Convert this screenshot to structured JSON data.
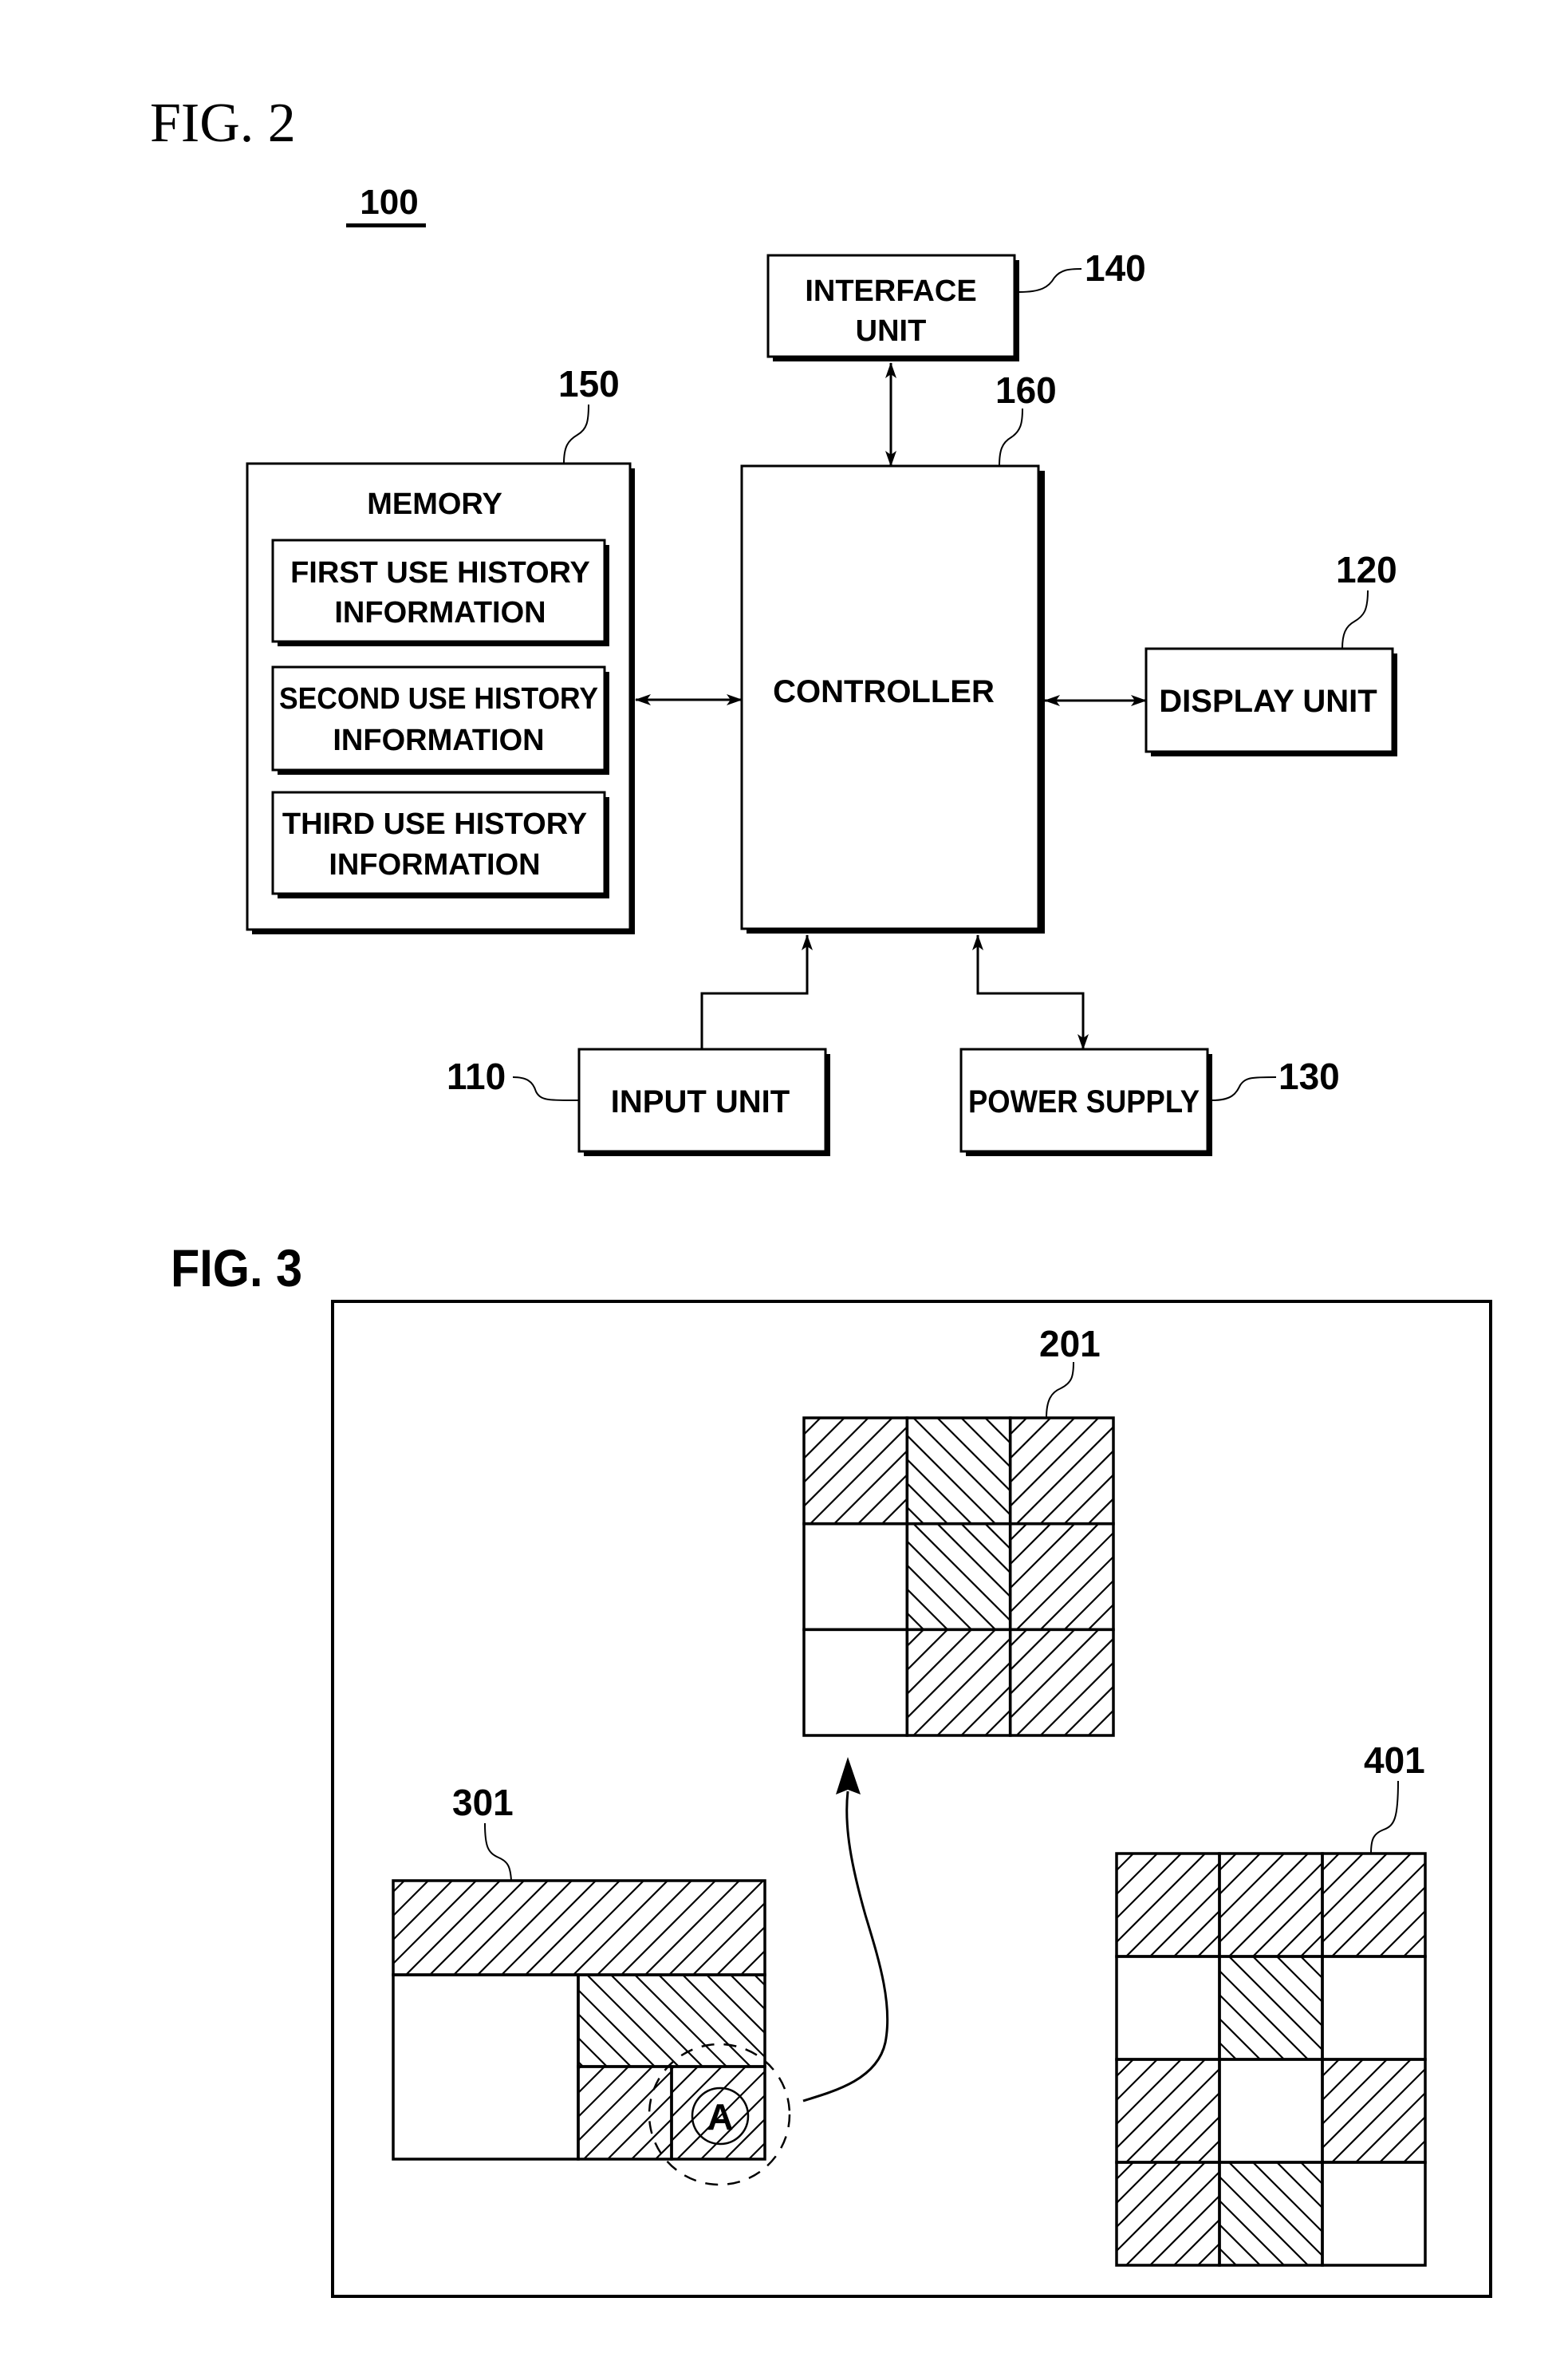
{
  "fig2": {
    "title": "FIG. 2",
    "system_ref": "100",
    "blocks": {
      "interface": {
        "ref": "140",
        "lines": [
          "INTERFACE",
          "UNIT"
        ]
      },
      "controller": {
        "ref": "160",
        "lines": [
          "CONTROLLER"
        ]
      },
      "memory": {
        "ref": "150",
        "title": "MEMORY",
        "items": [
          {
            "lines": [
              "FIRST USE HISTORY",
              "INFORMATION"
            ]
          },
          {
            "lines": [
              "SECOND USE HISTORY",
              "INFORMATION"
            ]
          },
          {
            "lines": [
              "THIRD USE HISTORY",
              "INFORMATION"
            ]
          }
        ]
      },
      "display": {
        "ref": "120",
        "lines": [
          "DISPLAY UNIT"
        ]
      },
      "input": {
        "ref": "110",
        "lines": [
          "INPUT UNIT"
        ]
      },
      "power": {
        "ref": "130",
        "lines": [
          "POWER SUPPLY"
        ]
      }
    },
    "connections": [
      {
        "from": "interface",
        "to": "controller",
        "type": "bidirectional"
      },
      {
        "from": "memory",
        "to": "controller",
        "type": "bidirectional"
      },
      {
        "from": "controller",
        "to": "display",
        "type": "bidirectional"
      },
      {
        "from": "input",
        "to": "controller",
        "type": "unidirectional"
      },
      {
        "from": "power",
        "to": "controller",
        "type": "bidirectional"
      }
    ]
  },
  "fig3": {
    "title": "FIG. 3",
    "detail_marker": "A",
    "grids": {
      "g201": {
        "ref": "201",
        "cols": 3,
        "rows": 3,
        "cells": [
          [
            "fwd",
            "back",
            "fwd"
          ],
          [
            "none",
            "back",
            "fwd"
          ],
          [
            "none",
            "fwd",
            "fwd"
          ]
        ]
      },
      "g301": {
        "ref": "301",
        "regions": [
          {
            "name": "top-band",
            "hatch": "fwd"
          },
          {
            "name": "left-empty",
            "hatch": "none"
          },
          {
            "name": "mid-right",
            "hatch": "back"
          },
          {
            "name": "bottom-right-a",
            "hatch": "fwd"
          },
          {
            "name": "bottom-right-b",
            "hatch": "fwd"
          }
        ]
      },
      "g401": {
        "ref": "401",
        "cols": 3,
        "rows": 4,
        "cells": [
          [
            "fwd",
            "fwd",
            "fwd"
          ],
          [
            "none",
            "back",
            "none"
          ],
          [
            "fwd",
            "none",
            "fwd"
          ],
          [
            "fwd",
            "back",
            "none"
          ]
        ]
      }
    }
  }
}
